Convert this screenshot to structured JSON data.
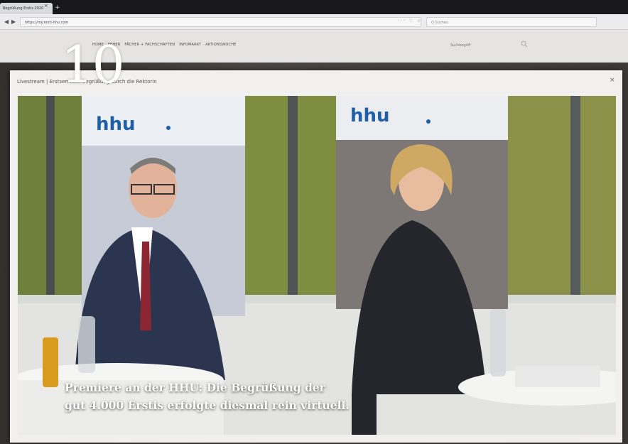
{
  "browser": {
    "tab_title": "Begrüßung Erstis 2020",
    "tab_close": "×",
    "new_tab": "+",
    "back": "◀",
    "forward": "▶",
    "url": "https://my.ersti-hhu.com",
    "addr_icons": "··· ♡ ☆",
    "search_placeholder": "Q Suchen"
  },
  "site": {
    "nav": [
      "HOME",
      "FEHER",
      "FÄCHER + FACHSCHAFTEN",
      "INFOMARKT",
      "AKTIONSWOCHE"
    ],
    "search_placeholder": "Suchbegriff"
  },
  "modal": {
    "title": "Livestream | Erstsemesterbegrüßung durch die Rektorin",
    "close": "×"
  },
  "slide_number": "10",
  "photo": {
    "banner_logo": "hhu",
    "caption_line1": "Premiere an der HHU: Die Begrüßung der",
    "caption_line2": "gut 4.000 Erstis erfolgte diesmal rein virtuell."
  },
  "colors": {
    "hhu_blue": "#1f5fa8",
    "frame": "#f1f0ef",
    "suit_dark": "#24262b",
    "navy_suit": "#2c3550"
  }
}
